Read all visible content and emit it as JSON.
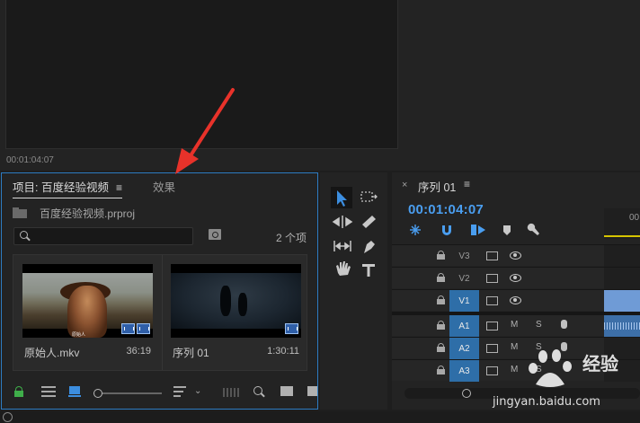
{
  "source_monitor": {
    "timecode": "00:01:04:07"
  },
  "project_panel": {
    "tab_project": "项目: 百度经验视频",
    "tab_project_menu": "≡",
    "tab_effects": "效果",
    "project_file": "百度经验视频.prproj",
    "search_placeholder": "",
    "item_count": "2 个项",
    "items": [
      {
        "name": "原始人.mkv",
        "duration": "36:19",
        "subtitle": "原始人"
      },
      {
        "name": "序列 01",
        "duration": "1:30:11"
      }
    ]
  },
  "timeline": {
    "close": "×",
    "title": "序列 01",
    "menu": "≡",
    "timecode": "00:01:04:07",
    "ruler_label": "00",
    "tracks": [
      {
        "name": "V3",
        "type": "video",
        "targeted": false
      },
      {
        "name": "V2",
        "type": "video",
        "targeted": false
      },
      {
        "name": "V1",
        "type": "video",
        "targeted": true
      },
      {
        "name": "A1",
        "type": "audio",
        "targeted": true,
        "mute": "M",
        "solo": "S"
      },
      {
        "name": "A2",
        "type": "audio",
        "targeted": true,
        "mute": "M",
        "solo": "S"
      },
      {
        "name": "A3",
        "type": "audio",
        "targeted": true,
        "mute": "M",
        "solo": "S"
      }
    ]
  },
  "watermark": {
    "brand": "经验",
    "url": "jingyan.baidu.com"
  },
  "colors": {
    "accent": "#2d7cc2",
    "timecode": "#4a9ef0",
    "annotation_arrow": "#e8322a"
  }
}
